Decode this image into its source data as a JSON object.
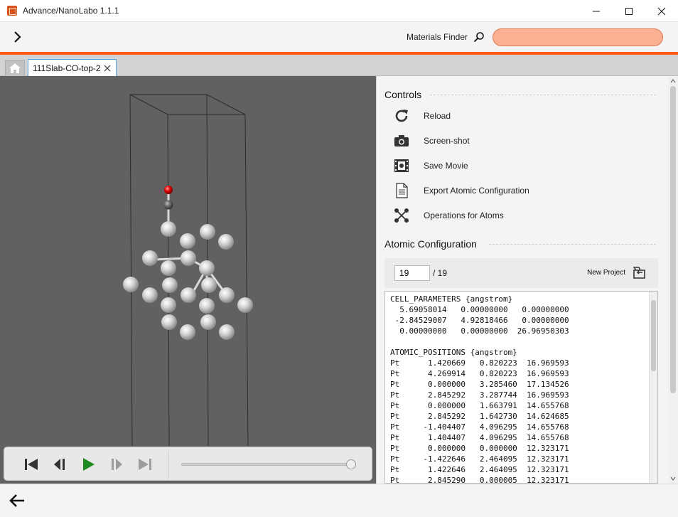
{
  "window": {
    "title": "Advance/NanoLabo 1.1.1"
  },
  "toolbar": {
    "finder_label": "Materials Finder",
    "finder_value": ""
  },
  "tabs": {
    "active_label": "111Slab-CO-top-2"
  },
  "controls": {
    "title": "Controls",
    "items": [
      {
        "label": "Reload",
        "icon": "reload-icon"
      },
      {
        "label": "Screen-shot",
        "icon": "camera-icon"
      },
      {
        "label": "Save Movie",
        "icon": "film-icon"
      },
      {
        "label": "Export Atomic Configuration",
        "icon": "document-icon"
      },
      {
        "label": "Operations for Atoms",
        "icon": "atoms-icon"
      }
    ]
  },
  "atomic_config": {
    "title": "Atomic Configuration",
    "frame_value": "19",
    "frame_total": "/ 19",
    "new_project_label": "New Project",
    "text_lines": [
      "CELL_PARAMETERS {angstrom}",
      "  5.69058014   0.00000000   0.00000000",
      " -2.84529007   4.92818466   0.00000000",
      "  0.00000000   0.00000000  26.96950303",
      "",
      "ATOMIC_POSITIONS {angstrom}",
      "Pt      1.420669   0.820223  16.969593",
      "Pt      4.269914   0.820223  16.969593",
      "Pt      0.000000   3.285460  17.134526",
      "Pt      2.845292   3.287744  16.969593",
      "Pt      0.000000   1.663791  14.655768",
      "Pt      2.845292   1.642730  14.624685",
      "Pt     -1.404407   4.096295  14.655768",
      "Pt      1.404407   4.096295  14.655768",
      "Pt      0.000000   0.000000  12.323171",
      "Pt     -1.422646   2.464095  12.323171",
      "Pt      1.422646   2.464095  12.323171",
      "Pt      2.845290   0.000005  12.323171"
    ]
  },
  "player": {
    "position_fraction": 1.0
  },
  "colors": {
    "accent": "#ff5a1a",
    "search_fill": "#fbb093",
    "play_green": "#1f8a1f",
    "oxygen": "#e00000"
  }
}
